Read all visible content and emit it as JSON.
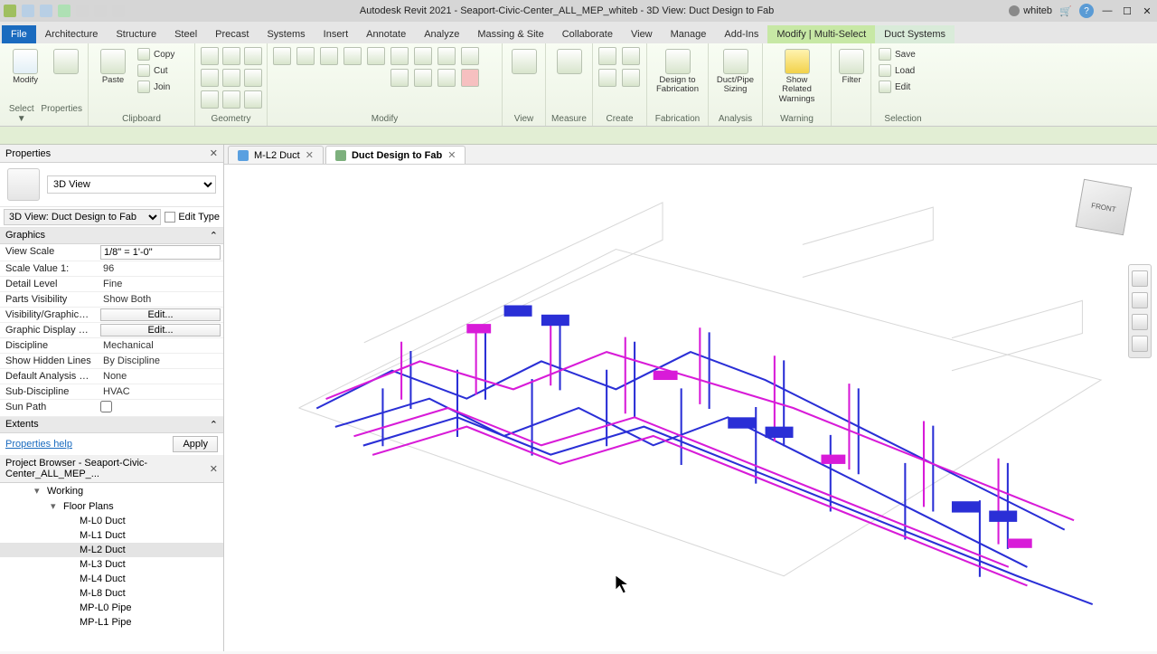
{
  "titlebar": {
    "title": "Autodesk Revit 2021 - Seaport-Civic-Center_ALL_MEP_whiteb - 3D View: Duct Design to Fab",
    "user": "whiteb"
  },
  "menu": {
    "file": "File",
    "tabs": [
      "Architecture",
      "Structure",
      "Steel",
      "Precast",
      "Systems",
      "Insert",
      "Annotate",
      "Analyze",
      "Massing & Site",
      "Collaborate",
      "View",
      "Manage",
      "Add-Ins"
    ],
    "active_tab": "Modify | Multi-Select",
    "sys_tab": "Duct Systems"
  },
  "ribbon": {
    "select": {
      "modify": "Modify",
      "label": "Select ▼",
      "props": "Properties"
    },
    "clipboard": {
      "paste": "Paste",
      "copy": "Copy",
      "cut": "Cut",
      "join": "Join",
      "label": "Clipboard"
    },
    "geometry": {
      "label": "Geometry"
    },
    "modify": {
      "label": "Modify"
    },
    "view": {
      "label": "View"
    },
    "measure": {
      "label": "Measure"
    },
    "create": {
      "label": "Create"
    },
    "fabrication": {
      "design": "Design to Fabrication",
      "label": "Fabrication"
    },
    "analysis": {
      "sizing": "Duct/Pipe Sizing",
      "label": "Analysis"
    },
    "warning": {
      "show": "Show Related Warnings",
      "label": "Warning"
    },
    "filter": {
      "filter": "Filter"
    },
    "selection": {
      "save": "Save",
      "load": "Load",
      "edit": "Edit",
      "label": "Selection"
    }
  },
  "properties": {
    "title": "Properties",
    "type": "3D View",
    "instance": "3D View: Duct Design to Fab",
    "edit_type": "Edit Type",
    "groups": {
      "graphics": "Graphics",
      "extents": "Extents"
    },
    "rows": {
      "view_scale": {
        "k": "View Scale",
        "v": "1/8\" = 1'-0\""
      },
      "scale_value": {
        "k": "Scale Value    1:",
        "v": "96"
      },
      "detail_level": {
        "k": "Detail Level",
        "v": "Fine"
      },
      "parts_vis": {
        "k": "Parts Visibility",
        "v": "Show Both"
      },
      "vg": {
        "k": "Visibility/Graphics Ov...",
        "v": "Edit..."
      },
      "gdo": {
        "k": "Graphic Display Optio...",
        "v": "Edit..."
      },
      "discipline": {
        "k": "Discipline",
        "v": "Mechanical"
      },
      "hidden": {
        "k": "Show Hidden Lines",
        "v": "By Discipline"
      },
      "dad": {
        "k": "Default Analysis Displ...",
        "v": "None"
      },
      "subdisc": {
        "k": "Sub-Discipline",
        "v": "HVAC"
      },
      "sunpath": {
        "k": "Sun Path",
        "v": false
      }
    },
    "help": "Properties help",
    "apply": "Apply"
  },
  "browser": {
    "title": "Project Browser - Seaport-Civic-Center_ALL_MEP_...",
    "working": "Working",
    "floor_plans": "Floor Plans",
    "items": [
      "M-L0 Duct",
      "M-L1 Duct",
      "M-L2 Duct",
      "M-L3 Duct",
      "M-L4 Duct",
      "M-L8 Duct",
      "MP-L0 Pipe",
      "MP-L1 Pipe"
    ],
    "selected": "M-L2 Duct"
  },
  "viewtabs": {
    "tab1": "M-L2 Duct",
    "tab2": "Duct Design to Fab"
  },
  "viewcube": {
    "face": "FRONT"
  }
}
